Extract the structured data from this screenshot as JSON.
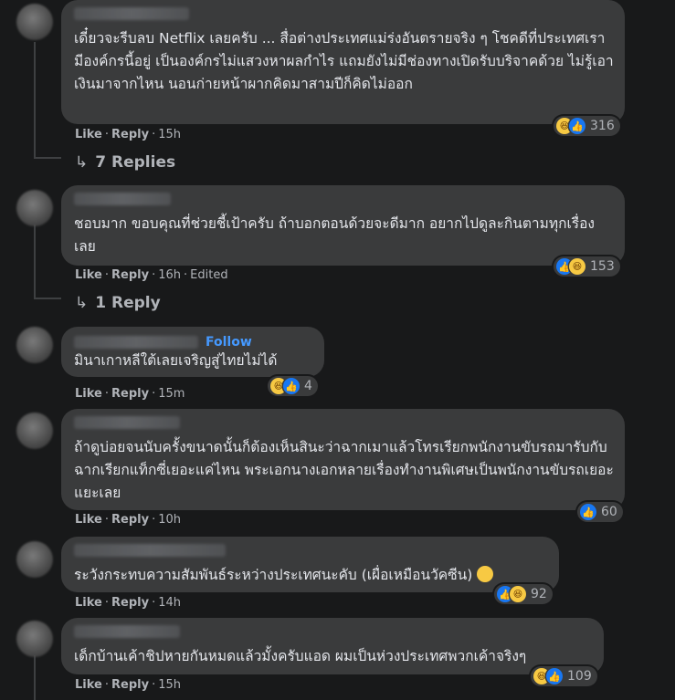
{
  "comments": [
    {
      "text": "เดี๋ยวจะรีบลบ Netflix เลยครับ ... สื่อต่างประเทศแม่ร่งอันตรายจริง ๆ โชคดีที่ประเทศเรามีองค์กรนี้อยู่ เป็นองค์กรไม่แสวงหาผลกำไร แถมยังไม่มีช่องทางเปิดรับบริจาคด้วย ไม่รู้เอาเงินมาจากไหน นอนก่ายหน้าผากคิดมาสามปีก็คิดไม่ออก",
      "like": "Like",
      "reply": "Reply",
      "time": "15h",
      "reactions": [
        "haha-icon",
        "like-icon"
      ],
      "count": "316",
      "replies_label": "7 Replies"
    },
    {
      "text": "ชอบมาก ขอบคุณที่ช่วยชี้เป้าครับ ถ้าบอกตอนด้วยจะดีมาก อยากไปดูละกินตามทุกเรื่องเลย",
      "like": "Like",
      "reply": "Reply",
      "time": "16h",
      "edited": "Edited",
      "reactions": [
        "like-icon",
        "haha-icon"
      ],
      "count": "153",
      "replies_label": "1 Reply"
    },
    {
      "follow": "Follow",
      "text": "มินาเกาหลีใต้เลยเจริญสู่ไทยไม่ได้",
      "like": "Like",
      "reply": "Reply",
      "time": "15m",
      "reactions": [
        "haha-icon",
        "like-icon"
      ],
      "count": "4"
    },
    {
      "text": "ถ้าดูบ่อยจนนับครั้งขนาดนั้นก็ต้องเห็นสินะว่าฉากเมาแล้วโทรเรียกพนักงานขับรถมารับกับฉากเรียกแท็กซี่เยอะแค่ไหน พระเอกนางเอกหลายเรื่องทำงานพิเศษเป็นพนักงานขับรถเยอะแยะเลย",
      "like": "Like",
      "reply": "Reply",
      "time": "10h",
      "reactions": [
        "like-icon"
      ],
      "count": "60"
    },
    {
      "text": "ระวังกระทบความสัมพันธ์ระหว่างประเทศนะคับ (เผื่อเหมือนวัคซีน)",
      "emoji": "sweat-smile-emoji",
      "like": "Like",
      "reply": "Reply",
      "time": "14h",
      "reactions": [
        "like-icon",
        "haha-icon"
      ],
      "count": "92"
    },
    {
      "text": "เด็กบ้านเค้าชิปหายกันหมดแล้วมั้งครับแอด ผมเป็นห่วงประเทศพวกเค้าจริงๆ",
      "like": "Like",
      "reply": "Reply",
      "time": "15h",
      "reactions": [
        "haha-icon",
        "like-icon"
      ],
      "count": "109"
    }
  ],
  "colors": {
    "background": "#18191a",
    "bubble": "#3a3b3c",
    "text": "#e4e6eb",
    "muted": "#b0b3b8",
    "link": "#4599ff",
    "like": "#1877f2",
    "haha": "#f7c943"
  }
}
